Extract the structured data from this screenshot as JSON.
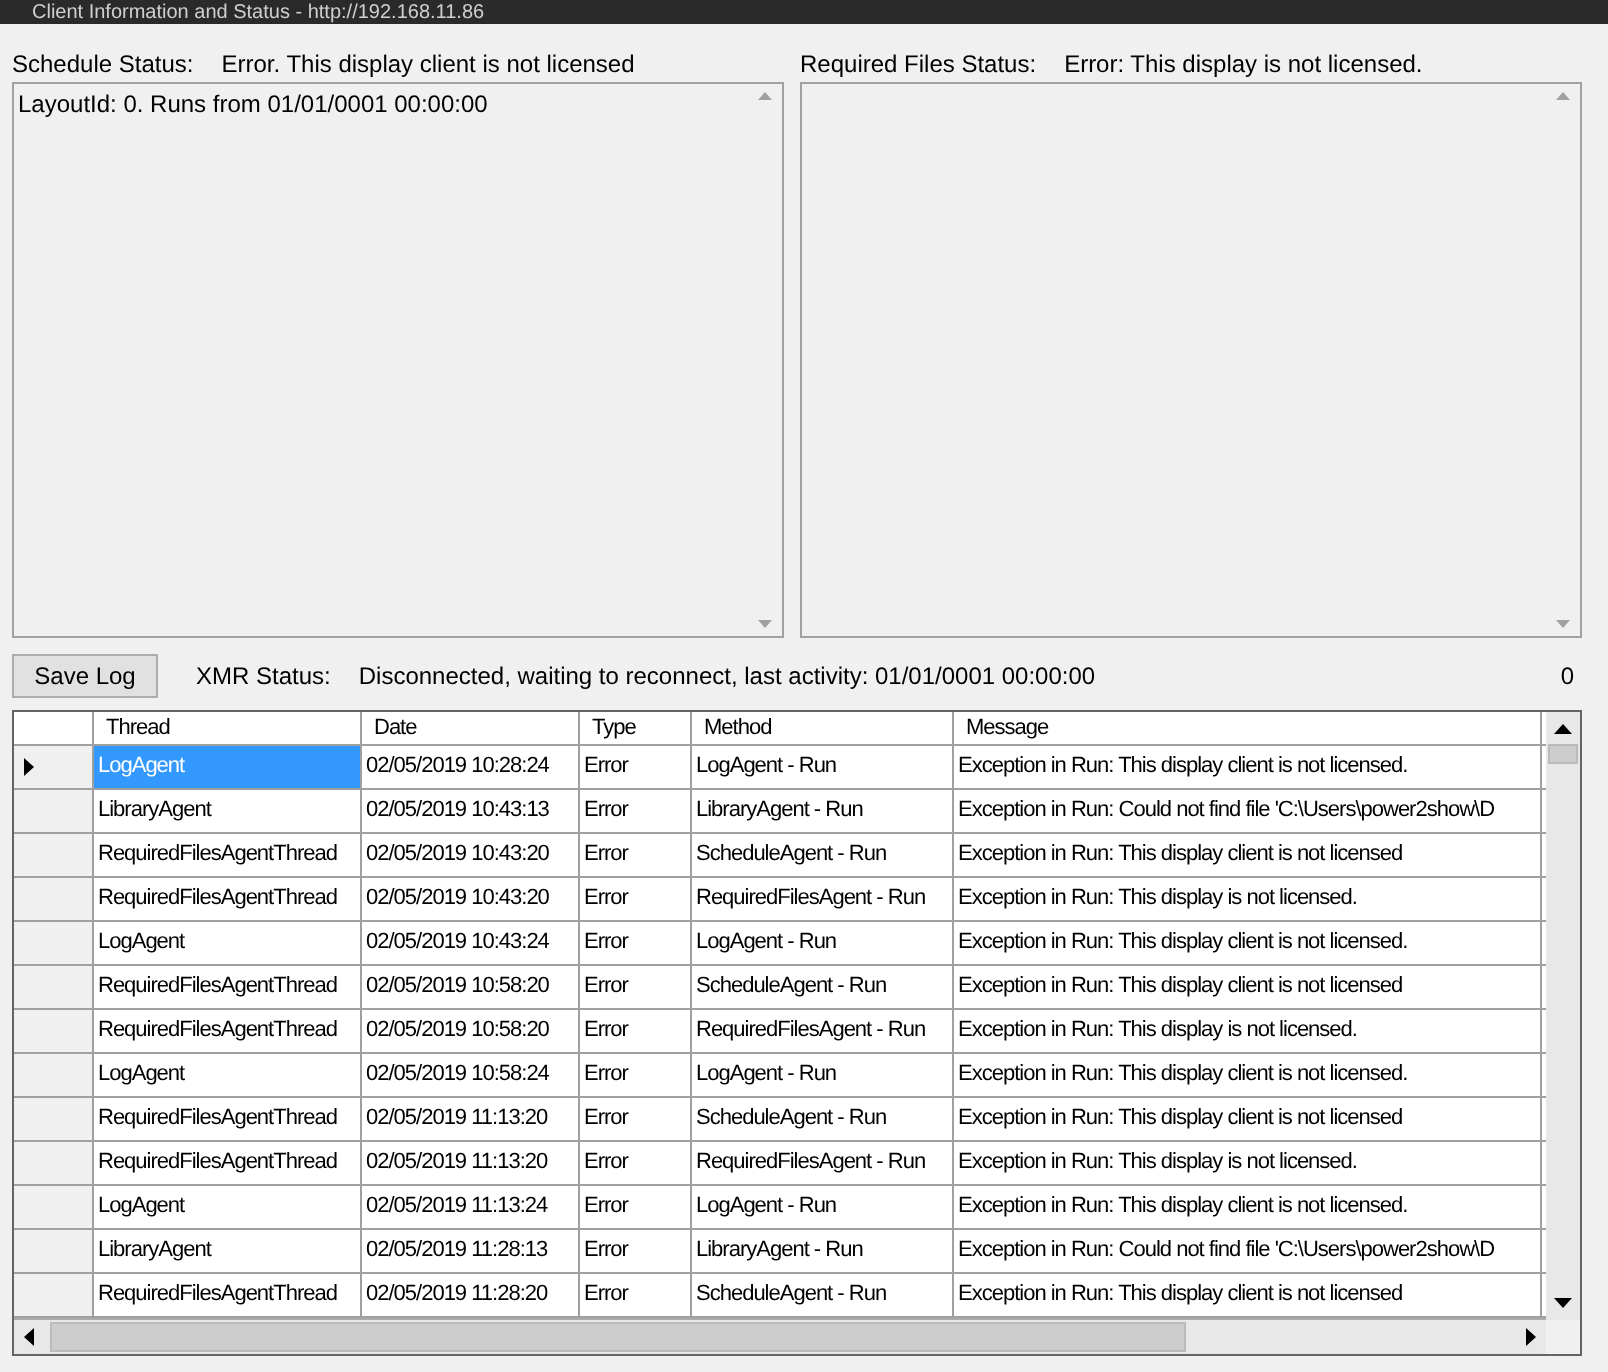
{
  "window": {
    "title": "Client Information and Status - http://192.168.11.86"
  },
  "schedule_status": {
    "label": "Schedule Status:",
    "value": "Error. This display client is not licensed",
    "content": "LayoutId: 0. Runs from 01/01/0001 00:00:00"
  },
  "required_files_status": {
    "label": "Required Files Status:",
    "value": "Error: This display is not licensed."
  },
  "save_log_button": "Save Log",
  "xmr_status": {
    "label": "XMR Status:",
    "value": "Disconnected, waiting to reconnect, last activity: 01/01/0001 00:00:00",
    "count": "0"
  },
  "log_table": {
    "columns": [
      "Thread",
      "Date",
      "Type",
      "Method",
      "Message"
    ],
    "rows": [
      {
        "selected": true,
        "cells": [
          "LogAgent",
          "02/05/2019 10:28:24",
          "Error",
          "LogAgent - Run",
          "Exception in Run: This display client is not licensed."
        ]
      },
      {
        "selected": false,
        "cells": [
          "LibraryAgent",
          "02/05/2019 10:43:13",
          "Error",
          "LibraryAgent - Run",
          "Exception in Run: Could not find file 'C:\\Users\\power2show\\D"
        ]
      },
      {
        "selected": false,
        "cells": [
          "RequiredFilesAgentThread",
          "02/05/2019 10:43:20",
          "Error",
          "ScheduleAgent - Run",
          "Exception in Run: This display client is not licensed"
        ]
      },
      {
        "selected": false,
        "cells": [
          "RequiredFilesAgentThread",
          "02/05/2019 10:43:20",
          "Error",
          "RequiredFilesAgent - Run",
          "Exception in Run: This display is not licensed."
        ]
      },
      {
        "selected": false,
        "cells": [
          "LogAgent",
          "02/05/2019 10:43:24",
          "Error",
          "LogAgent - Run",
          "Exception in Run: This display client is not licensed."
        ]
      },
      {
        "selected": false,
        "cells": [
          "RequiredFilesAgentThread",
          "02/05/2019 10:58:20",
          "Error",
          "ScheduleAgent - Run",
          "Exception in Run: This display client is not licensed"
        ]
      },
      {
        "selected": false,
        "cells": [
          "RequiredFilesAgentThread",
          "02/05/2019 10:58:20",
          "Error",
          "RequiredFilesAgent - Run",
          "Exception in Run: This display is not licensed."
        ]
      },
      {
        "selected": false,
        "cells": [
          "LogAgent",
          "02/05/2019 10:58:24",
          "Error",
          "LogAgent - Run",
          "Exception in Run: This display client is not licensed."
        ]
      },
      {
        "selected": false,
        "cells": [
          "RequiredFilesAgentThread",
          "02/05/2019 11:13:20",
          "Error",
          "ScheduleAgent - Run",
          "Exception in Run: This display client is not licensed"
        ]
      },
      {
        "selected": false,
        "cells": [
          "RequiredFilesAgentThread",
          "02/05/2019 11:13:20",
          "Error",
          "RequiredFilesAgent - Run",
          "Exception in Run: This display is not licensed."
        ]
      },
      {
        "selected": false,
        "cells": [
          "LogAgent",
          "02/05/2019 11:13:24",
          "Error",
          "LogAgent - Run",
          "Exception in Run: This display client is not licensed."
        ]
      },
      {
        "selected": false,
        "cells": [
          "LibraryAgent",
          "02/05/2019 11:28:13",
          "Error",
          "LibraryAgent - Run",
          "Exception in Run: Could not find file 'C:\\Users\\power2show\\D"
        ]
      },
      {
        "selected": false,
        "cells": [
          "RequiredFilesAgentThread",
          "02/05/2019 11:28:20",
          "Error",
          "ScheduleAgent - Run",
          "Exception in Run: This display client is not licensed"
        ]
      }
    ]
  }
}
